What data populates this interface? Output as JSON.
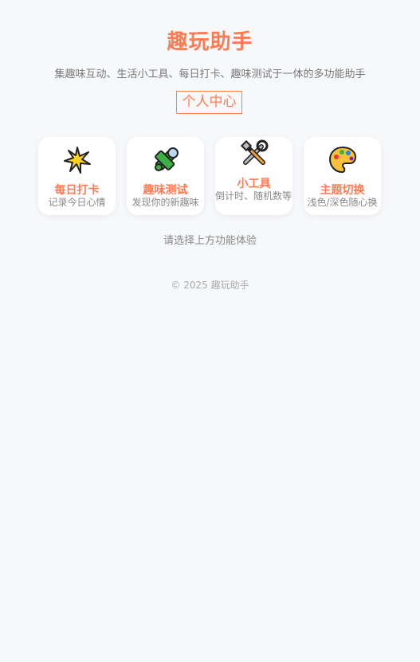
{
  "header": {
    "title": "趣玩助手",
    "subtitle": "集趣味互动、生活小工具、每日打卡、趣味测试于一体的多功能助手",
    "profile_button": "个人中心"
  },
  "features": [
    {
      "icon": "star-icon",
      "label": "每日打卡",
      "desc": "记录今日心情"
    },
    {
      "icon": "puzzle-icon",
      "label": "趣味测试",
      "desc": "发现你的新趣味"
    },
    {
      "icon": "tools-icon",
      "label": "小工具",
      "desc": "倒计时、随机数等"
    },
    {
      "icon": "palette-icon",
      "label": "主题切换",
      "desc": "浅色/深色随心换"
    }
  ],
  "hint": "请选择上方功能体验",
  "footer": "© 2025 趣玩助手",
  "colors": {
    "accent": "#ff7b54",
    "background": "#f7f8fa",
    "card": "#ffffff"
  }
}
